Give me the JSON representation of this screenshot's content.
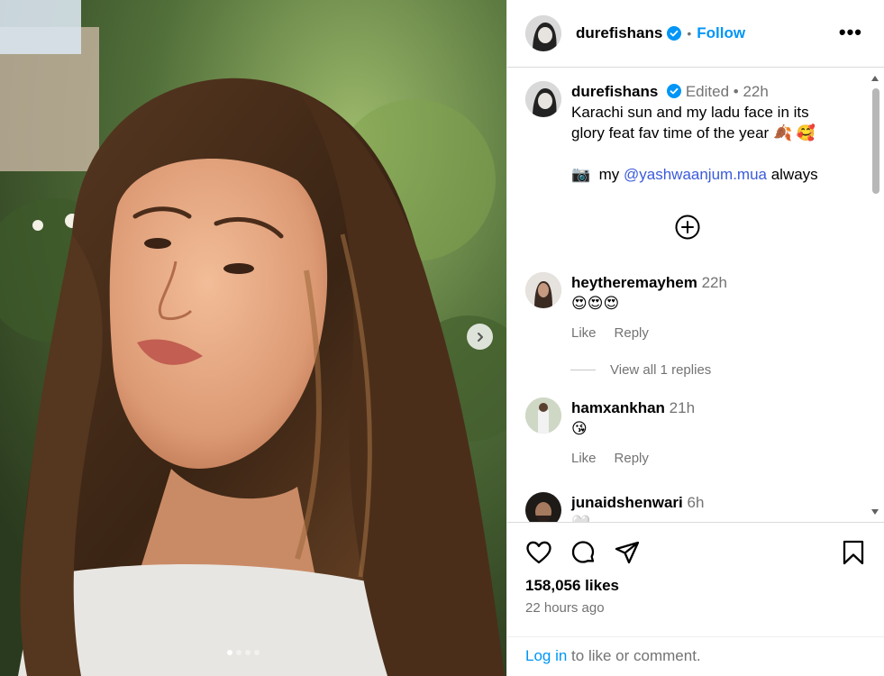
{
  "post": {
    "author": "durefishans",
    "follow_label": "Follow",
    "more_label": "•••",
    "separator": "•",
    "carousel_index": 1,
    "carousel_count": 4
  },
  "caption": {
    "username": "durefishans",
    "edited": "Edited",
    "sep": "•",
    "time": "22h",
    "line1": "Karachi sun and my ladu face in its glory feat fav time of the year 🍂 🥰",
    "credit_prefix": "📷  my ",
    "credit_mention": "@yashwaanjum.mua",
    "credit_suffix": " always"
  },
  "comments": [
    {
      "username": "heytheremayhem",
      "time": "22h",
      "text": "😍😍😍",
      "like": "Like",
      "reply": "Reply"
    },
    {
      "username": "hamxankhan",
      "time": "21h",
      "text": "😘",
      "like": "Like",
      "reply": "Reply"
    },
    {
      "username": "junaidshenwari",
      "time": "6h",
      "text": "🤍 ... ..."
    }
  ],
  "view_replies": "View all 1 replies",
  "stats": {
    "likes": "158,056 likes",
    "time_ago": "22 hours ago"
  },
  "login": {
    "link": "Log in",
    "rest": " to like or comment."
  },
  "colors": {
    "accent": "#0095f6",
    "verified": "#0095f6",
    "muted": "#737373"
  }
}
